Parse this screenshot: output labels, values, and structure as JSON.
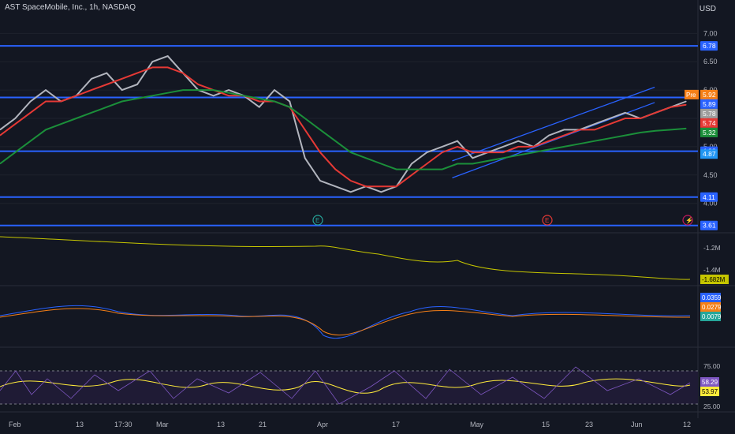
{
  "header": {
    "title": "AST SpaceMobile, Inc., 1h, NASDAQ",
    "currency": "USD"
  },
  "chart_data": {
    "type": "line",
    "main": {
      "ylim": [
        3.55,
        7.2
      ],
      "y_ticks": [
        "7.00",
        "6.50",
        "6.00",
        "5.50",
        "5.00",
        "4.50",
        "4.00"
      ],
      "horizontal_levels": [
        {
          "label": "6.78",
          "value": 6.78
        },
        {
          "label": "5.87",
          "value": 5.87
        },
        {
          "label": "4.92",
          "value": 4.92
        },
        {
          "label": "4.11",
          "value": 4.11
        },
        {
          "label": "3.61",
          "value": 3.61
        }
      ],
      "price_labels": [
        {
          "label": "Pre",
          "value": 5.92,
          "color": "#f57f17"
        },
        {
          "label": "5.92",
          "value": 5.92,
          "color": "#f57f17"
        },
        {
          "label": "5.89",
          "value": 5.89,
          "color": "#2962ff"
        },
        {
          "label": "5.78",
          "value": 5.78,
          "color": "#9e9e9e"
        },
        {
          "label": "5.74",
          "value": 5.74,
          "color": "#e53935"
        },
        {
          "label": "5.32",
          "value": 5.32,
          "color": "#1b8f3a"
        },
        {
          "label": "4.87",
          "value": 4.87,
          "color": "#2196f3"
        }
      ],
      "series": [
        {
          "color": "#b2b5be",
          "values": [
            5.3,
            5.5,
            5.8,
            6.0,
            5.8,
            5.9,
            6.2,
            6.3,
            6.0,
            6.1,
            6.5,
            6.6,
            6.3,
            6.0,
            5.9,
            6.0,
            5.9,
            5.7,
            6.0,
            5.8,
            4.8,
            4.4,
            4.3,
            4.2,
            4.3,
            4.2,
            4.3,
            4.7,
            4.9,
            5.0,
            5.1,
            4.8,
            4.9,
            5.0,
            5.1,
            5.0,
            5.2,
            5.3,
            5.3,
            5.4,
            5.5,
            5.6,
            5.5,
            5.6,
            5.7,
            5.8
          ]
        },
        {
          "color": "#e53935",
          "values": [
            5.2,
            5.4,
            5.6,
            5.8,
            5.8,
            5.9,
            6.0,
            6.1,
            6.2,
            6.3,
            6.4,
            6.4,
            6.3,
            6.1,
            6.0,
            5.9,
            5.9,
            5.8,
            5.8,
            5.7,
            5.3,
            4.9,
            4.6,
            4.4,
            4.3,
            4.3,
            4.3,
            4.5,
            4.7,
            4.9,
            5.0,
            4.9,
            4.9,
            4.9,
            5.0,
            5.0,
            5.1,
            5.2,
            5.3,
            5.3,
            5.4,
            5.5,
            5.5,
            5.6,
            5.7,
            5.74
          ]
        },
        {
          "color": "#1b8f3a",
          "values": [
            4.7,
            4.9,
            5.1,
            5.3,
            5.4,
            5.5,
            5.6,
            5.7,
            5.8,
            5.85,
            5.9,
            5.95,
            6.0,
            6.0,
            6.0,
            5.95,
            5.9,
            5.85,
            5.8,
            5.7,
            5.5,
            5.3,
            5.1,
            4.9,
            4.8,
            4.7,
            4.6,
            4.6,
            4.6,
            4.6,
            4.7,
            4.7,
            4.75,
            4.8,
            4.85,
            4.9,
            4.95,
            5.0,
            5.05,
            5.1,
            5.15,
            5.2,
            5.25,
            5.28,
            5.3,
            5.32
          ]
        }
      ],
      "channel": [
        {
          "x0": 0.648,
          "y0": 4.45,
          "x1": 0.938,
          "y1": 5.78
        },
        {
          "x0": 0.648,
          "y0": 4.75,
          "x1": 0.938,
          "y1": 6.05
        }
      ]
    },
    "indicators": [
      {
        "name": "",
        "ticks": [
          "-1.2M",
          "-1.4M"
        ],
        "labels": [
          {
            "label": "-1.682M",
            "color": "#c5c500"
          }
        ]
      },
      {
        "name": "",
        "labels": [
          {
            "label": "0.0359",
            "color": "#2962ff"
          },
          {
            "label": "0.0279",
            "color": "#f57f17"
          },
          {
            "label": "0.0079",
            "color": "#26a69a"
          }
        ]
      },
      {
        "name": "",
        "ticks": [
          "75.00",
          "25.00"
        ],
        "labels": [
          {
            "label": "58.29",
            "color": "#7e57c2"
          },
          {
            "label": "53.97",
            "color": "#ffeb3b"
          }
        ]
      }
    ],
    "x_ticks": [
      "Feb",
      "13",
      "17:30",
      "Mar",
      "13",
      "21",
      "Apr",
      "17",
      "May",
      "15",
      "23",
      "Jun",
      "12"
    ],
    "event_markers": [
      {
        "label": "E",
        "color": "#26a69a"
      },
      {
        "label": "E",
        "color": "#e53935"
      },
      {
        "label": "⚡",
        "color": "#c2185b"
      }
    ]
  }
}
